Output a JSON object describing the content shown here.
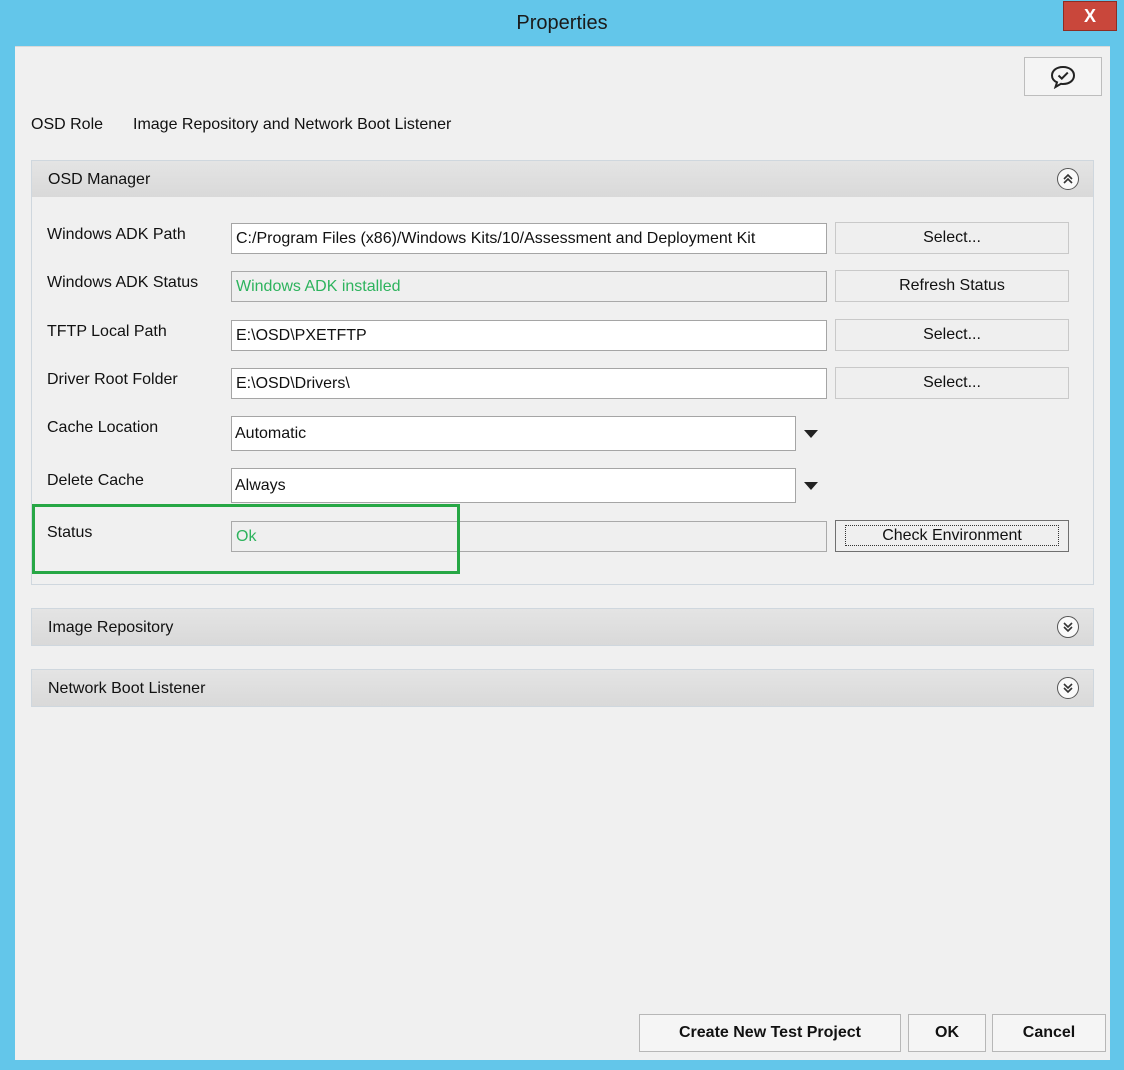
{
  "window": {
    "title": "Properties",
    "close_label": "X",
    "colors": {
      "frame": "#63c6ea",
      "close": "#c9473b",
      "ok_text": "#2db35d",
      "highlight": "#27a745"
    }
  },
  "toolbar": {
    "chat_icon": "chat-bubble-check-icon"
  },
  "role": {
    "label": "OSD Role",
    "value": "Image Repository and Network Boot Listener"
  },
  "osd_manager": {
    "title": "OSD Manager",
    "chevron_icon": "chevron-double-up-icon",
    "fields": {
      "adk_path": {
        "label": "Windows ADK Path",
        "value": "C:/Program Files (x86)/Windows Kits/10/Assessment and Deployment Kit",
        "button": "Select..."
      },
      "adk_status": {
        "label": "Windows ADK Status",
        "value": "Windows ADK installed",
        "button": "Refresh Status"
      },
      "tftp_path": {
        "label": "TFTP Local Path",
        "value": "E:\\OSD\\PXETFTP",
        "button": "Select..."
      },
      "driver_root": {
        "label": "Driver Root Folder",
        "value": "E:\\OSD\\Drivers\\",
        "button": "Select..."
      },
      "cache_location": {
        "label": "Cache Location",
        "value": "Automatic"
      },
      "delete_cache": {
        "label": "Delete Cache",
        "value": "Always"
      },
      "status": {
        "label": "Status",
        "value": "Ok",
        "button": "Check Environment"
      }
    }
  },
  "image_repository": {
    "title": "Image Repository",
    "chevron_icon": "chevron-double-down-icon"
  },
  "network_boot_listener": {
    "title": "Network Boot Listener",
    "chevron_icon": "chevron-double-down-icon"
  },
  "footer": {
    "create_project": "Create New Test Project",
    "ok": "OK",
    "cancel": "Cancel"
  }
}
